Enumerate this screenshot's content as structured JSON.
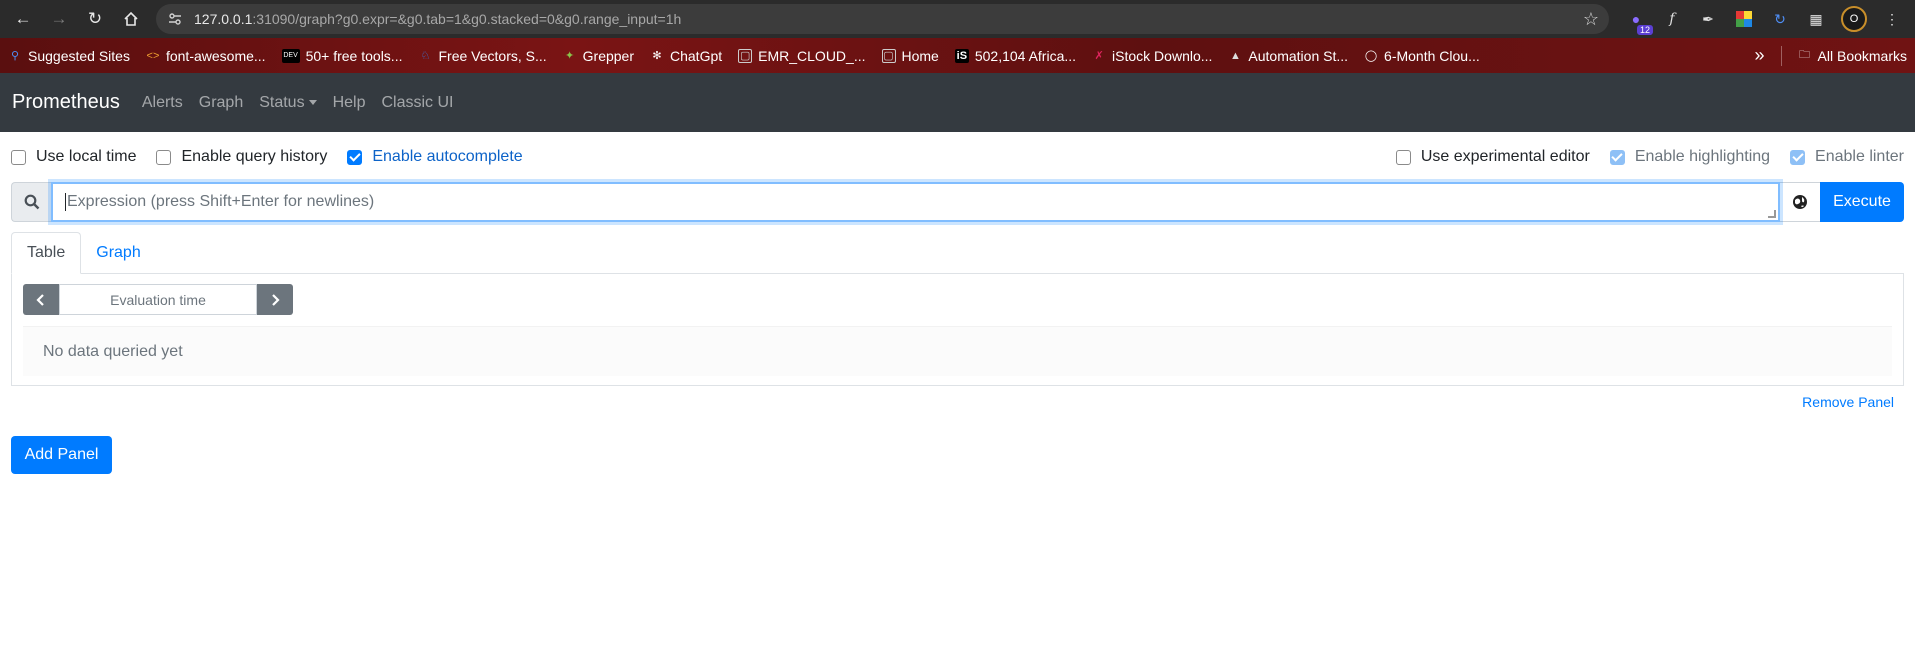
{
  "browser": {
    "url_host": "127.0.0.1",
    "url_rest": ":31090/graph?g0.expr=&g0.tab=1&g0.stacked=0&g0.range_input=1h",
    "extension_badge": "12",
    "avatar_letter": "O",
    "bookmarks": [
      {
        "label": "Suggested Sites",
        "icon": "search-icon",
        "color": "#4f8ff7"
      },
      {
        "label": "font-awesome...",
        "icon": "code-icon",
        "color": "#f0a030"
      },
      {
        "label": "50+ free tools...",
        "icon": "dev-icon",
        "color": "#ffffff"
      },
      {
        "label": "Free Vectors, S...",
        "icon": "vector-icon",
        "color": "#3a7be0"
      },
      {
        "label": "Grepper",
        "icon": "grepper-icon",
        "color": "#8bc34a"
      },
      {
        "label": "ChatGpt",
        "icon": "chatgpt-icon",
        "color": "#ffffff"
      },
      {
        "label": "EMR_CLOUD_...",
        "icon": "image-icon",
        "color": "#cccccc"
      },
      {
        "label": "Home",
        "icon": "image-icon",
        "color": "#cccccc"
      },
      {
        "label": "502,104 Africa...",
        "icon": "istock-icon",
        "color": "#ffffff"
      },
      {
        "label": "iStock Downlo...",
        "icon": "istock-icon",
        "color": "#e0245e"
      },
      {
        "label": "Automation St...",
        "icon": "triangle-icon",
        "color": "#dddddd"
      },
      {
        "label": "6-Month Clou...",
        "icon": "circle-icon",
        "color": "#ffffff"
      }
    ],
    "all_bookmarks": "All Bookmarks"
  },
  "nav": {
    "brand": "Prometheus",
    "links": [
      "Alerts",
      "Graph",
      "Status",
      "Help",
      "Classic UI"
    ]
  },
  "options": {
    "use_local_time": {
      "label": "Use local time",
      "checked": false
    },
    "enable_query_history": {
      "label": "Enable query history",
      "checked": false
    },
    "enable_autocomplete": {
      "label": "Enable autocomplete",
      "checked": true
    },
    "use_experimental_editor": {
      "label": "Use experimental editor",
      "checked": false
    },
    "enable_highlighting": {
      "label": "Enable highlighting",
      "checked": true
    },
    "enable_linter": {
      "label": "Enable linter",
      "checked": true
    }
  },
  "expression": {
    "placeholder": "Expression (press Shift+Enter for newlines)",
    "value": "",
    "execute_label": "Execute"
  },
  "tabs": {
    "table": "Table",
    "graph": "Graph",
    "active": "Table"
  },
  "table": {
    "eval_time_placeholder": "Evaluation time",
    "no_data": "No data queried yet"
  },
  "remove_panel": "Remove Panel",
  "add_panel": "Add Panel"
}
